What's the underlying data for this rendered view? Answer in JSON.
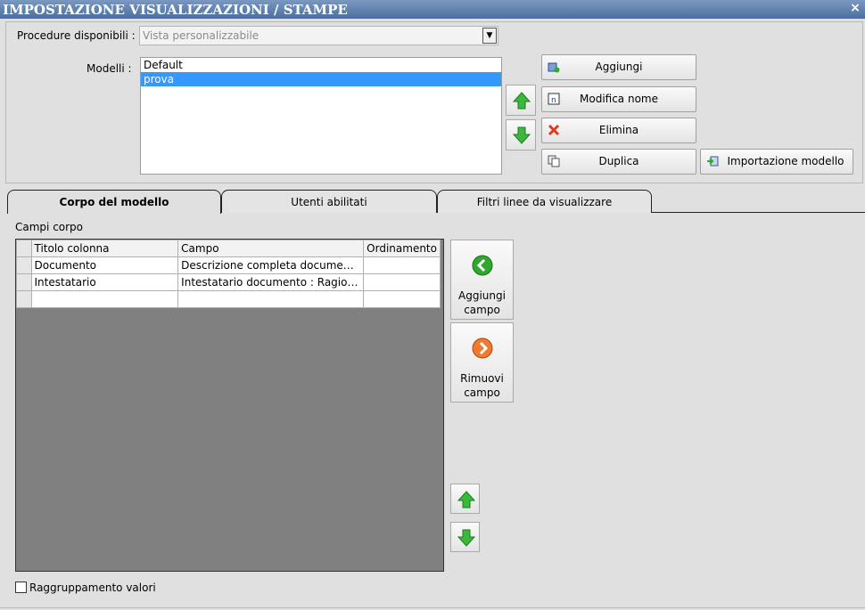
{
  "window": {
    "title": "IMPOSTAZIONE VISUALIZZAZIONI / STAMPE",
    "close_glyph": "×"
  },
  "procedure": {
    "label": "Procedure disponibili :",
    "selected": "Vista personalizzabile",
    "arrow_glyph": "▼"
  },
  "modelli": {
    "label": "Modelli :",
    "items": [
      "Default",
      "prova"
    ],
    "selected_index": 1
  },
  "buttons": {
    "aggiungi": "Aggiungi",
    "modifica_nome": "Modifica nome",
    "elimina": "Elimina",
    "duplica": "Duplica",
    "importazione": "Importazione modello"
  },
  "tabs": [
    "Corpo del modello",
    "Utenti abilitati",
    "Filtri linee da visualizzare"
  ],
  "campi_corpo": {
    "label": "Campi corpo",
    "columns": [
      "Titolo colonna",
      "Campo",
      "Ordinamento"
    ],
    "rows": [
      [
        "Documento",
        "Descrizione completa documento...",
        ""
      ],
      [
        "Intestatario",
        "Intestatario documento : Ragion...",
        ""
      ],
      [
        "",
        "",
        ""
      ]
    ]
  },
  "side_buttons": {
    "aggiungi_line1": "Aggiungi",
    "aggiungi_line2": "campo",
    "rimuovi_line1": "Rimuovi",
    "rimuovi_line2": "campo"
  },
  "raggruppamento": {
    "label": "Raggruppamento valori",
    "checked": false
  },
  "colors": {
    "title_bar": "#4d6e9e",
    "selection": "#3399ff",
    "grid_background": "#808080",
    "arrow_green": "#3cb83c",
    "add_green": "#2ea82e",
    "remove_orange": "#f07a30"
  }
}
